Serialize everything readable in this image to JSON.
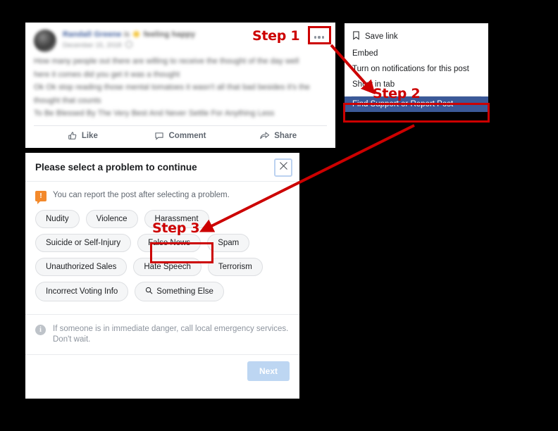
{
  "background_color": "#000000",
  "annotation_color": "#cc0000",
  "annotations": [
    {
      "id": "step1",
      "label": "Step 1",
      "target": "post-more-button"
    },
    {
      "id": "step2",
      "label": "Step 2",
      "target": "menu-item-find-support-or-report-post"
    },
    {
      "id": "step3",
      "label": "Step 3",
      "target": "chip-false-news"
    }
  ],
  "post": {
    "author_name": "Randall Greene",
    "author_connector": "is",
    "author_feeling": "feeling happy",
    "timestamp": "December 15, 2018",
    "privacy_icon": "globe-icon",
    "body_lines": [
      "How many people out there are willing to receive the thought of the day well",
      "here it comes did you get it was a thought",
      "Ok Ok stop reading those mental tomatoes it wasn't all that bad besides it's the",
      "thought that counts",
      "To Be Blessed By The Very Best And Never Settle For Anything Less"
    ],
    "blurred": true,
    "actions": [
      {
        "label": "Like",
        "icon": "thumbs-up-icon"
      },
      {
        "label": "Comment",
        "icon": "comment-bubble-icon"
      },
      {
        "label": "Share",
        "icon": "share-arrow-icon"
      }
    ],
    "more_button": {
      "icon": "ellipsis-icon",
      "highlighted": true
    }
  },
  "menu": {
    "items": [
      {
        "label": "Save link",
        "icon": "bookmark-icon",
        "highlighted": false
      },
      {
        "label": "Embed",
        "icon": null,
        "highlighted": false
      },
      {
        "label": "Turn on notifications for this post",
        "icon": null,
        "highlighted": false
      },
      {
        "label": "Show in tab",
        "icon": null,
        "highlighted": false
      }
    ],
    "highlighted_item": {
      "label": "Find Support or Report Post",
      "background_color": "#3b5998",
      "text_color": "#ffffff"
    }
  },
  "dialog": {
    "title": "Please select a problem to continue",
    "close_icon": "close-x-icon",
    "notice": {
      "icon": "warning-exclamation-icon",
      "icon_color": "#f3892b",
      "text": "You can report the post after selecting a problem."
    },
    "chips": [
      {
        "label": "Nudity",
        "icon": null,
        "selected": false
      },
      {
        "label": "Violence",
        "icon": null,
        "selected": false
      },
      {
        "label": "Harassment",
        "icon": null,
        "selected": false
      },
      {
        "label": "Suicide or Self-Injury",
        "icon": null,
        "selected": false
      },
      {
        "label": "False News",
        "icon": null,
        "selected": false,
        "highlighted": true
      },
      {
        "label": "Spam",
        "icon": null,
        "selected": false
      },
      {
        "label": "Unauthorized Sales",
        "icon": null,
        "selected": false
      },
      {
        "label": "Hate Speech",
        "icon": null,
        "selected": false
      },
      {
        "label": "Terrorism",
        "icon": null,
        "selected": false
      },
      {
        "label": "Incorrect Voting Info",
        "icon": null,
        "selected": false
      },
      {
        "label": "Something Else",
        "icon": "search-icon",
        "selected": false
      }
    ],
    "footer_note": {
      "icon": "info-circle-icon",
      "text": "If someone is in immediate danger, call local emergency services. Don't wait."
    },
    "next_button": {
      "label": "Next",
      "disabled": true,
      "background_color": "#bdd6f2"
    }
  }
}
